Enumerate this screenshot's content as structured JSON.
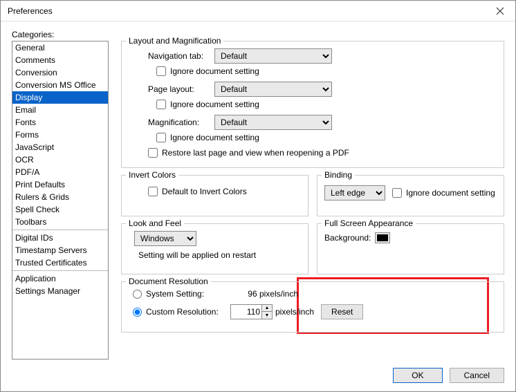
{
  "window": {
    "title": "Preferences"
  },
  "categories_label": "Categories:",
  "categories": {
    "group1": [
      "General",
      "Comments",
      "Conversion",
      "Conversion MS Office",
      "Display",
      "Email",
      "Fonts",
      "Forms",
      "JavaScript",
      "OCR",
      "PDF/A",
      "Print Defaults",
      "Rulers & Grids",
      "Spell Check",
      "Toolbars"
    ],
    "group2": [
      "Digital IDs",
      "Timestamp Servers",
      "Trusted Certificates"
    ],
    "group3": [
      "Application",
      "Settings Manager"
    ],
    "selected": "Display"
  },
  "layoutMag": {
    "title": "Layout and Magnification",
    "navLabel": "Navigation tab:",
    "navValue": "Default",
    "ignore": "Ignore document setting",
    "pageLabel": "Page layout:",
    "pageValue": "Default",
    "magLabel": "Magnification:",
    "magValue": "Default",
    "restore": "Restore last page and view when reopening a PDF"
  },
  "invert": {
    "title": "Invert Colors",
    "option": "Default to Invert Colors"
  },
  "binding": {
    "title": "Binding",
    "value": "Left edge",
    "ignore": "Ignore document setting"
  },
  "look": {
    "title": "Look and Feel",
    "value": "Windows",
    "hint": "Setting will be applied on restart"
  },
  "fullscreen": {
    "title": "Full Screen Appearance",
    "bgLabel": "Background:",
    "bgColor": "#000000"
  },
  "docres": {
    "title": "Document Resolution",
    "systemLabel": "System Setting:",
    "systemValue": "96 pixels/inch",
    "customLabel": "Custom Resolution:",
    "customValue": "110",
    "unit": "pixels/inch",
    "reset": "Reset"
  },
  "footer": {
    "ok": "OK",
    "cancel": "Cancel"
  }
}
